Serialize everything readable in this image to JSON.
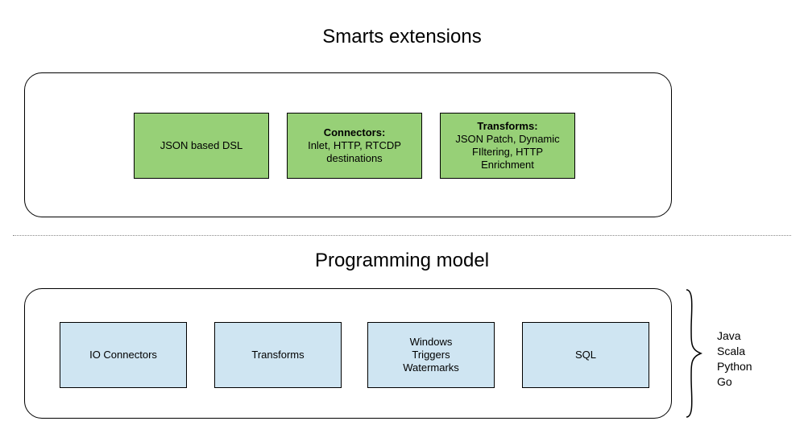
{
  "sections": {
    "top": {
      "title": "Smarts extensions",
      "boxes": {
        "dsl": {
          "label": "JSON based DSL"
        },
        "connectors": {
          "heading": "Connectors:",
          "detail": "Inlet, HTTP, RTCDP destinations"
        },
        "transforms": {
          "heading": "Transforms:",
          "detail": "JSON Patch, Dynamic FIltering, HTTP Enrichment"
        }
      }
    },
    "bottom": {
      "title": "Programming model",
      "boxes": {
        "io": {
          "label": "IO Connectors"
        },
        "tr": {
          "label": "Transforms"
        },
        "win": {
          "line1": "Windows",
          "line2": "Triggers",
          "line3": "Watermarks"
        },
        "sql": {
          "label": "SQL"
        }
      },
      "languages": [
        "Java",
        "Scala",
        "Python",
        "Go"
      ]
    }
  }
}
